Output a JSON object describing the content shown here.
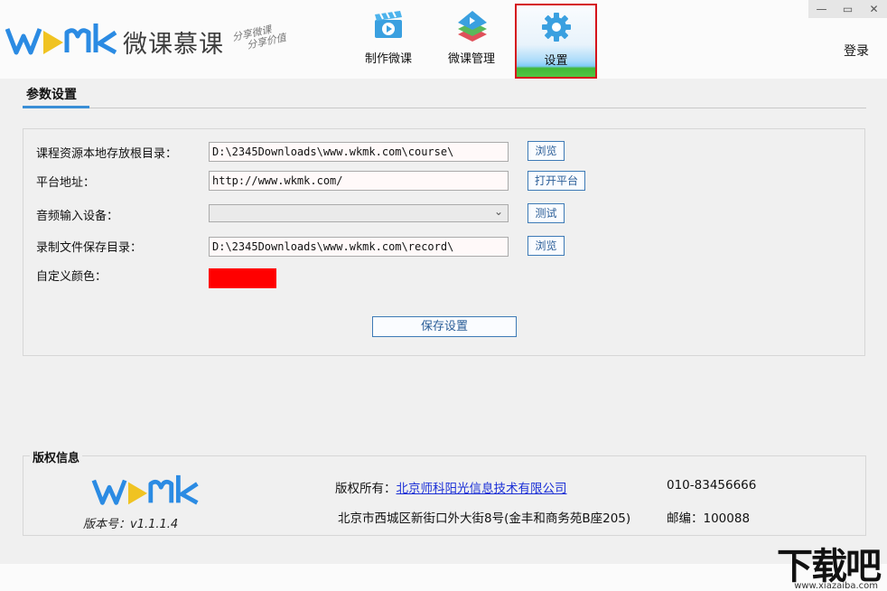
{
  "window": {
    "minimize_icon": "minimize-icon",
    "maximize_icon": "maximize-icon",
    "close_icon": "close-icon"
  },
  "header": {
    "logo_text": "微课慕课",
    "slogan_line1": "分享微课",
    "slogan_line2": "分享价值",
    "nav": [
      {
        "label": "制作微课",
        "icon": "video-clapper-icon",
        "active": false
      },
      {
        "label": "微课管理",
        "icon": "layers-icon",
        "active": false
      },
      {
        "label": "设置",
        "icon": "gear-icon",
        "active": true
      }
    ],
    "login_label": "登录"
  },
  "section": {
    "title": "参数设置"
  },
  "settings": {
    "course_dir": {
      "label": "课程资源本地存放根目录：",
      "value": "D:\\2345Downloads\\www.wkmk.com\\course\\",
      "button": "浏览"
    },
    "platform": {
      "label": "平台地址：",
      "value": "http://www.wkmk.com/",
      "button": "打开平台"
    },
    "audio": {
      "label": "音频输入设备：",
      "value": "",
      "button": "测试"
    },
    "record_dir": {
      "label": "录制文件保存目录：",
      "value": "D:\\2345Downloads\\www.wkmk.com\\record\\",
      "button": "浏览"
    },
    "color": {
      "label": "自定义颜色：",
      "value": "#ff0000"
    },
    "save_button": "保存设置"
  },
  "copyright": {
    "title": "版权信息",
    "version": "版本号：v1.1.1.4",
    "owner_label": "版权所有：",
    "owner_link": "北京师科阳光信息技术有限公司",
    "address": "北京市西城区新街口外大街8号(金丰和商务苑B座205)",
    "phone": "010-83456666",
    "postcode": "邮编：100088"
  },
  "watermark": {
    "main": "下载吧",
    "url": "www.xiazaiba.com"
  },
  "colors": {
    "accent": "#3a8fd6",
    "active_border": "#d5141c",
    "link": "#1a2fd6",
    "logo_blue": "#2b8be3",
    "logo_yellow": "#f0c322"
  }
}
